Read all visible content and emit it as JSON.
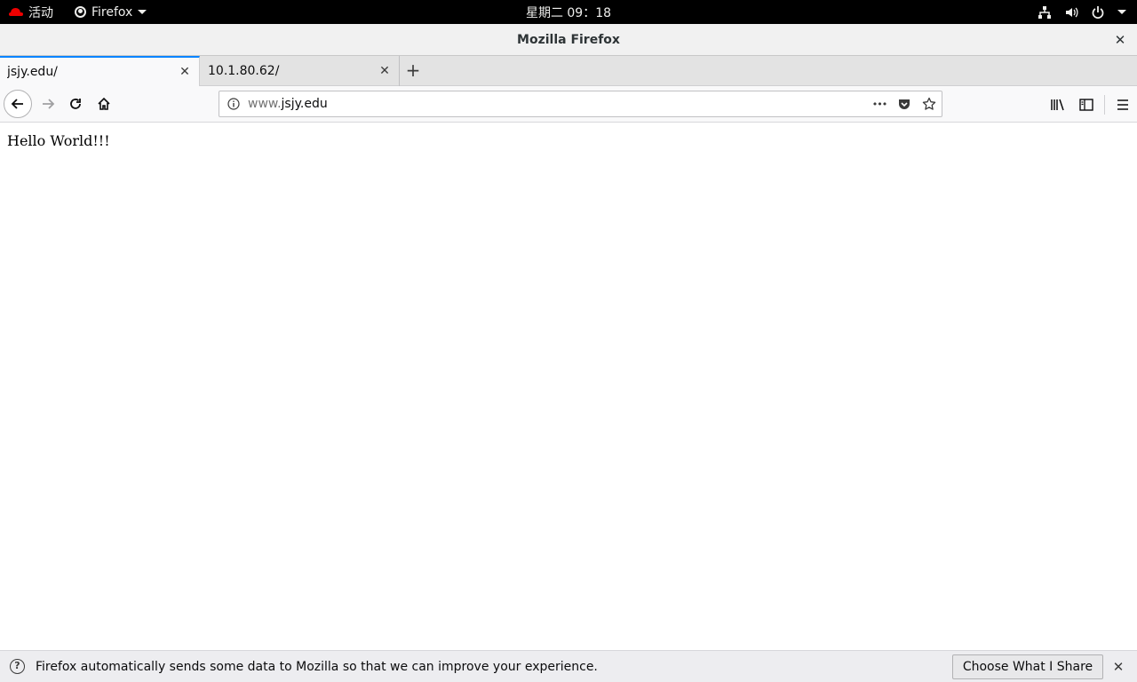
{
  "topbar": {
    "activities_label": "活动",
    "app_menu_label": "Firefox",
    "clock": "星期二 09：18"
  },
  "window": {
    "title": "Mozilla Firefox",
    "close_glyph": "✕"
  },
  "tabs": [
    {
      "label": "jsjy.edu/",
      "active": true
    },
    {
      "label": "10.1.80.62/",
      "active": false
    }
  ],
  "tab_close_glyph": "✕",
  "new_tab_glyph": "+",
  "urlbar": {
    "url_prefix": "www.",
    "url_domain": "jsjy.edu",
    "more_glyph": "•••"
  },
  "page": {
    "text": "Hello World!!!"
  },
  "notification": {
    "icon_glyph": "?",
    "message": "Firefox automatically sends some data to Mozilla so that we can improve your experience.",
    "button_label": "Choose What I Share",
    "close_glyph": "✕"
  },
  "colors": {
    "accent": "#0a84ff",
    "topbar_bg": "#000000",
    "redhat": "#ee0000"
  }
}
